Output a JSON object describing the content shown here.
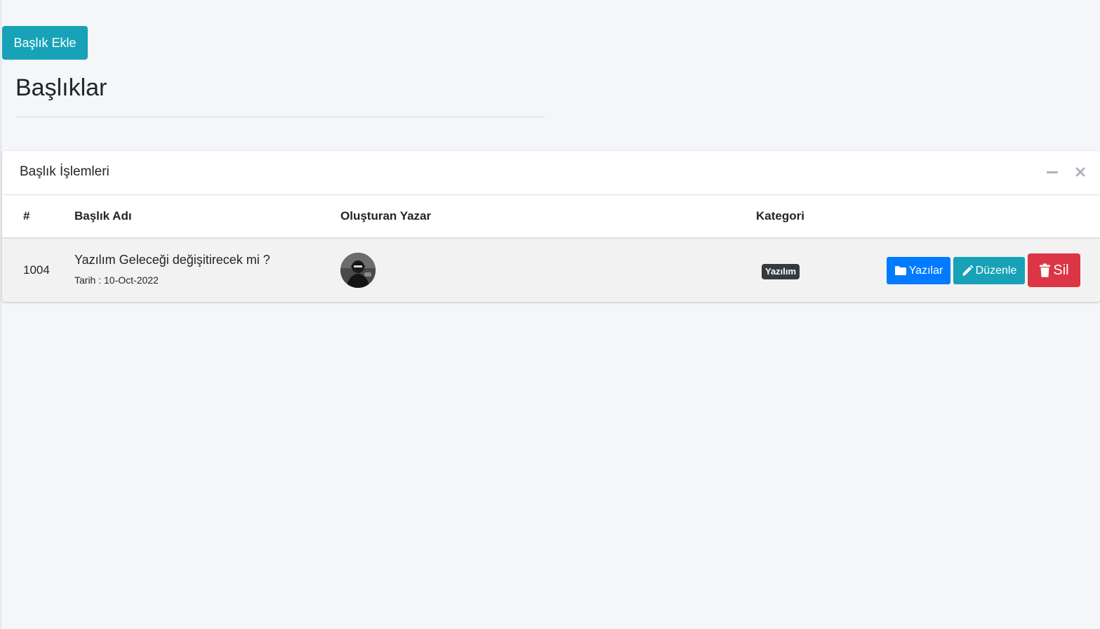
{
  "toolbar": {
    "add_label": "Başlık Ekle"
  },
  "page": {
    "title": "Başlıklar"
  },
  "card": {
    "title": "Başlık İşlemleri",
    "tools": [
      "minus-icon",
      "close-icon"
    ]
  },
  "table": {
    "columns": [
      "#",
      "Başlık Adı",
      "Oluşturan Yazar",
      "Kategori"
    ],
    "rows": [
      {
        "id": "1004",
        "title": "Yazılım Geleceği değişitirecek mi ?",
        "date_text": "Tarih : 10-Oct-2022",
        "author_avatar": "author-avatar",
        "category": "Yazılım",
        "actions": {
          "posts": "Yazılar",
          "edit": "Düzenle",
          "delete": "Sil"
        }
      }
    ]
  },
  "colors": {
    "page_bg": "#f4f6f9",
    "info": "#17a2b8",
    "primary": "#007bff",
    "danger": "#dc3545",
    "badge_dark": "#343a40",
    "row_striped": "#f2f2f2"
  }
}
